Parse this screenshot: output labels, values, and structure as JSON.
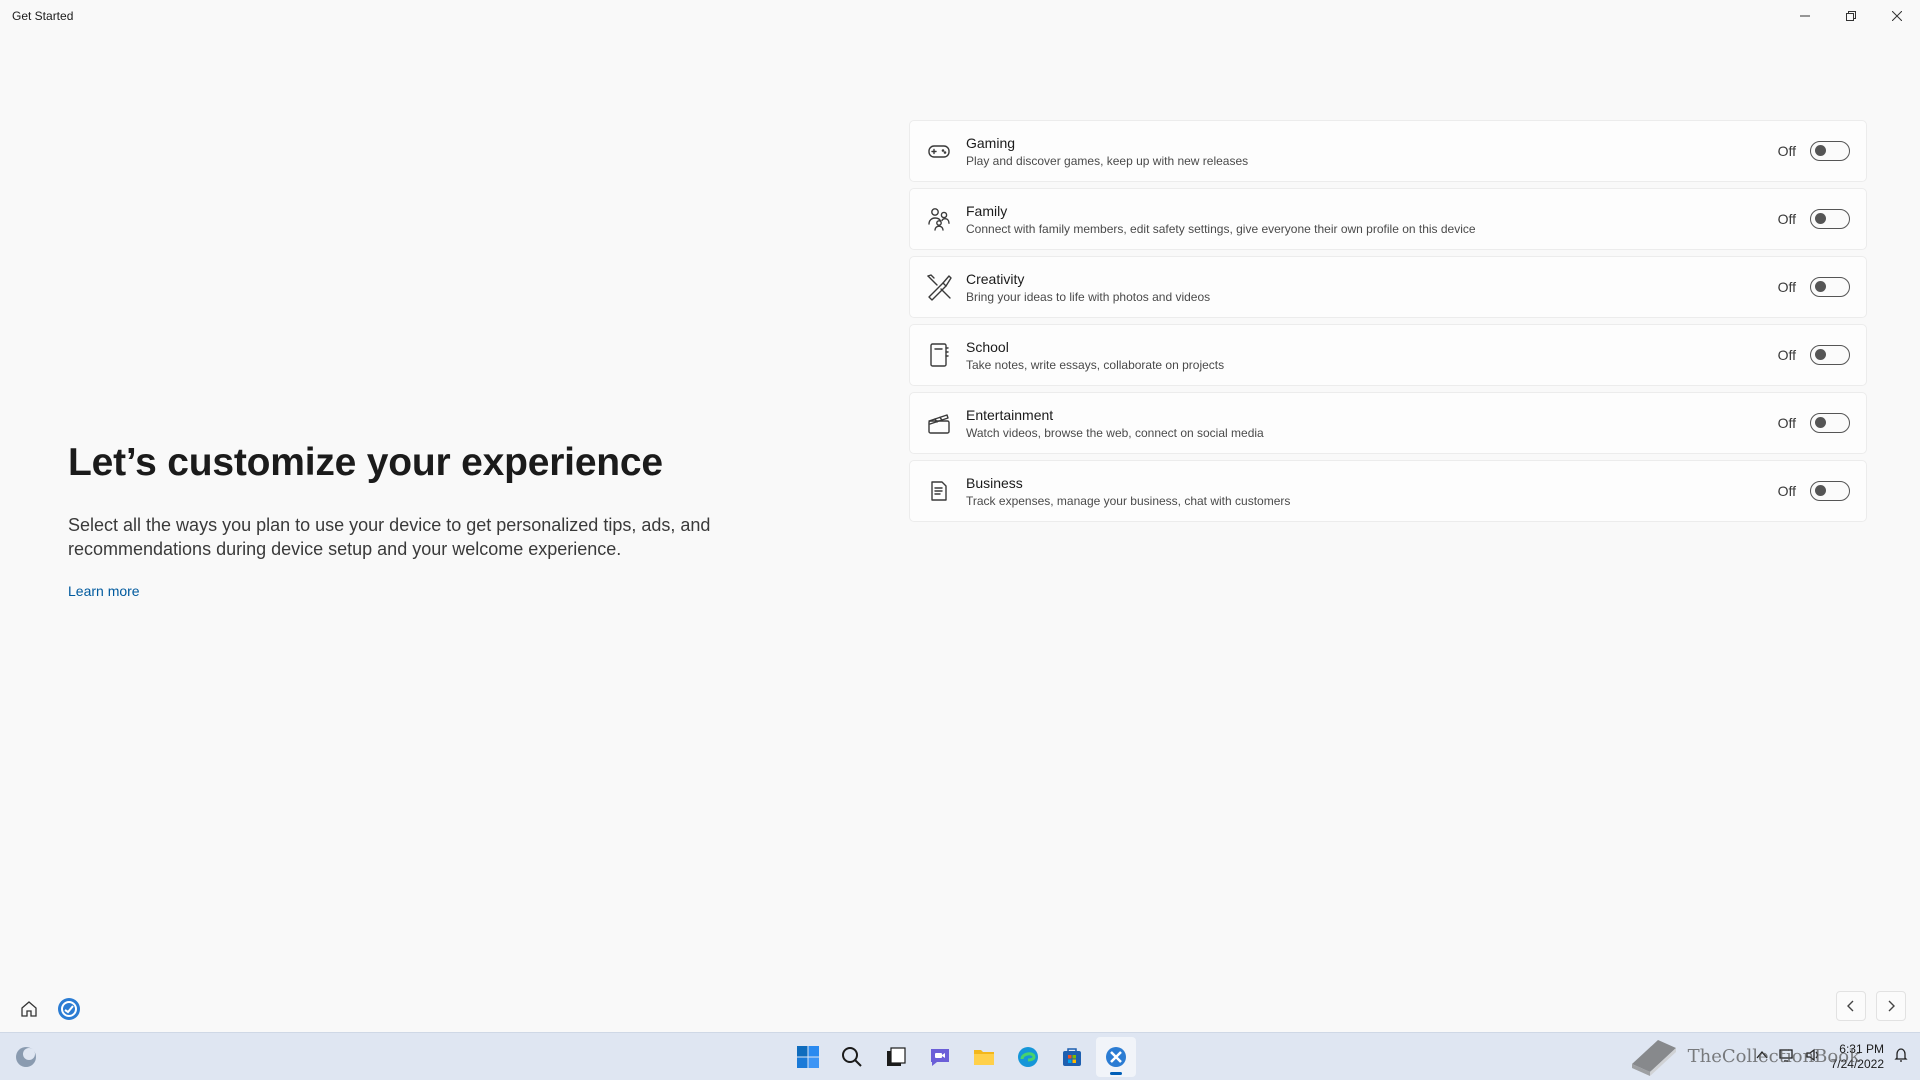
{
  "window": {
    "title": "Get Started",
    "controls": [
      "minimize-icon",
      "restore-icon",
      "close-icon"
    ]
  },
  "hero": {
    "heading": "Let’s customize your experience",
    "body": "Select all the ways you plan to use your device to get personalized tips, ads, and recommendations during device setup and your welcome experience.",
    "link": "Learn more"
  },
  "options": [
    {
      "icon": "gamepad-icon",
      "name": "Gaming",
      "desc": "Play and discover games, keep up with new releases",
      "state": "Off",
      "on": false
    },
    {
      "icon": "family-icon",
      "name": "Family",
      "desc": "Connect with family members, edit safety settings, give everyone their own profile on this device",
      "state": "Off",
      "on": false
    },
    {
      "icon": "creativity-icon",
      "name": "Creativity",
      "desc": "Bring your ideas to life with photos and videos",
      "state": "Off",
      "on": false
    },
    {
      "icon": "notebook-icon",
      "name": "School",
      "desc": "Take notes, write essays, collaborate on projects",
      "state": "Off",
      "on": false
    },
    {
      "icon": "clapperboard-icon",
      "name": "Entertainment",
      "desc": "Watch videos, browse the web, connect on social media",
      "state": "Off",
      "on": false
    },
    {
      "icon": "document-icon",
      "name": "Business",
      "desc": "Track expenses, manage your business, chat with customers",
      "state": "Off",
      "on": false
    }
  ],
  "taskbar": {
    "apps": [
      "start-icon",
      "search-icon",
      "task-view-icon",
      "chat-icon",
      "file-explorer-icon",
      "edge-icon",
      "store-icon",
      "get-started-icon"
    ],
    "active_app": "get-started-icon",
    "time": "6:31 PM",
    "date": "7/24/2022",
    "watermark": "TheCollectionBook"
  },
  "colors": {
    "accent": "#005fb8",
    "link": "#005a9e",
    "background": "#f9f9f9",
    "taskbar": "#dfe6f2"
  }
}
